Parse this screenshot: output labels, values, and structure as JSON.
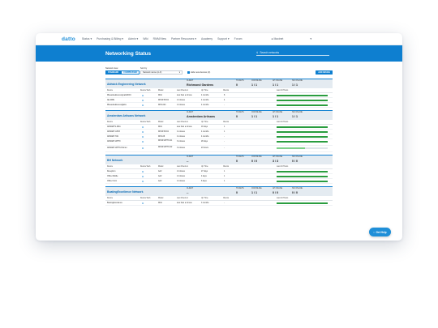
{
  "nav": {
    "logo": "datto",
    "items": [
      "Status",
      "Purchasing & Billing",
      "Admin",
      "Wiki",
      "RMM/View",
      "Partner Resources",
      "Academy",
      "Support",
      "Forum"
    ],
    "user": "Macinet"
  },
  "banner": {
    "title": "Networking Status",
    "search_placeholder": "Search networks"
  },
  "filters": {
    "view_label": "Network view",
    "view_options": [
      "STANDARD",
      "COMPRESSED"
    ],
    "sort_label": "Sort by",
    "sort_value": "Network name (A-Z)",
    "hide_label": "Hide new devices (3)",
    "add_label": "ADD DEVICE"
  },
  "metric_labels": {
    "client": "CLIENT",
    "tickets": "TICKETS",
    "online": "ON/ONLINE",
    "ap": "AP ONLINE",
    "switch": "SW ONLINE"
  },
  "column_labels": [
    "Device",
    "Device Web",
    "Model",
    "Last Check-in",
    "Up Time",
    "Clients",
    "Last 24 Hours"
  ],
  "networks": [
    {
      "name": "Aldwick Engineering Network",
      "client": "Richmond Gardens",
      "tickets": "0",
      "online": "1 / 1",
      "ap": "1 / 1",
      "switch": "1 / 1",
      "devices": [
        {
          "name": "Rbeaubeallenvesignalst0004",
          "model": "DNA",
          "checkin": "less than a minute",
          "uptime": "4 months",
          "clients": "8",
          "uptime_pct": 1.0
        },
        {
          "name": "AE-WPE",
          "model": "DNSP-8FO4",
          "checkin": "2 minutes",
          "uptime": "4 months",
          "clients": "4",
          "uptime_pct": 1.0
        },
        {
          "name": "Rbeaudeallenvesiglabs",
          "model": "DNS-024",
          "checkin": "2 minutes",
          "uptime": "4 months",
          "clients": "-",
          "uptime_pct": 1.0
        }
      ]
    },
    {
      "name": "Amsterdam Artisans Network",
      "client": "Amsterdam Artisans",
      "tickets": "0",
      "online": "1 / 1",
      "ap": "1 / 1",
      "switch": "1 / 1",
      "devices": [
        {
          "name": "AMSARTS-DNA",
          "model": "DNA",
          "checkin": "less than a minute",
          "uptime": "18 days",
          "clients": "1",
          "uptime_pct": 1.0
        },
        {
          "name": "AMSART-AP03",
          "model": "DNSP-8FO4",
          "checkin": "4 minutes",
          "uptime": "4 months",
          "clients": "1",
          "uptime_pct": 1.0
        },
        {
          "name": "AMSART-SW",
          "model": "DNS-08",
          "checkin": "4 minutes",
          "uptime": "4 months",
          "clients": "-",
          "uptime_pct": 1.0
        },
        {
          "name": "AMSART-WPT0",
          "model": "DNSP-WPTO-01",
          "checkin": "3 minutes",
          "uptime": "28 days",
          "clients": "-",
          "uptime_pct": 1.0
        },
        {
          "name": "AMSART-WPT0-Pointer",
          "model": "DNSP-WPTO-02",
          "checkin": "3 minutes",
          "uptime": "23 hours",
          "clients": "-",
          "uptime_pct": 0.55
        }
      ]
    },
    {
      "name": "BH Network",
      "client": "--",
      "tickets": "0",
      "online": "0 / 0",
      "ap": "3 / 3",
      "switch": "0 / 0",
      "devices": [
        {
          "name": "Reception",
          "model": "AA2",
          "checkin": "2 minutes",
          "uptime": "27 days",
          "clients": "1",
          "uptime_pct": 1.0
        },
        {
          "name": "Office Middle",
          "model": "AA2",
          "checkin": "2 minutes",
          "uptime": "4 days",
          "clients": "1",
          "uptime_pct": 1.0
        },
        {
          "name": "Office Front",
          "model": "AA2",
          "checkin": "2 minutes",
          "uptime": "6 days",
          "clients": "1",
          "uptime_pct": 1.0
        }
      ]
    },
    {
      "name": "BoatingExcellence Network",
      "client": "--",
      "tickets": "0",
      "online": "1 / 1",
      "ap": "0 / 0",
      "switch": "0 / 0",
      "devices": [
        {
          "name": "BoatingExcellence",
          "model": "DNA",
          "checkin": "less than a minute",
          "uptime": "3 months",
          "clients": "-",
          "uptime_pct": 1.0
        }
      ]
    }
  ],
  "help": {
    "label": "Get Help"
  },
  "colors": {
    "brand": "#0e7fd0",
    "good": "#2a9d3f"
  }
}
